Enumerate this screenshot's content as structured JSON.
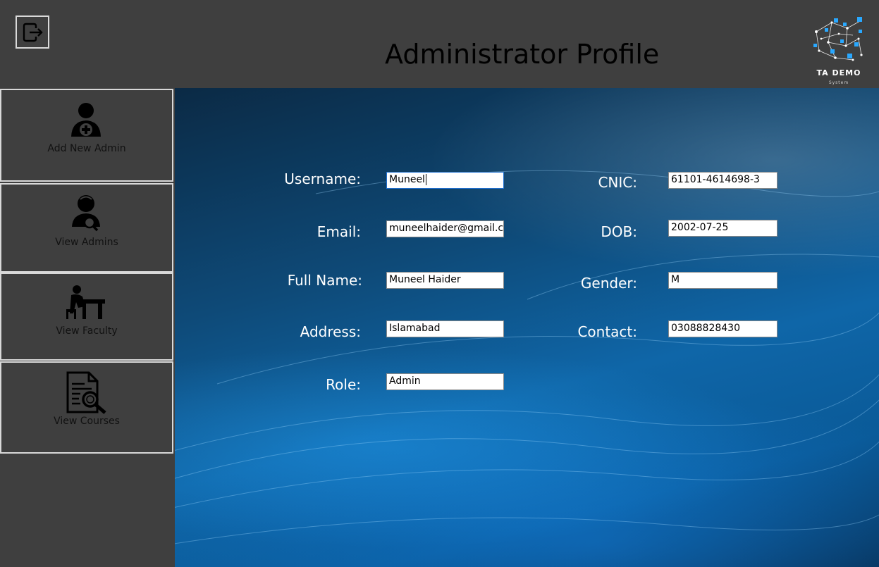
{
  "header": {
    "title": "Administrator Profile",
    "logout_icon": "logout-icon",
    "logo": {
      "name": "TA DEMO",
      "subtitle": "System"
    }
  },
  "sidebar": {
    "items": [
      {
        "label": "Add New Admin",
        "icon": "add-user-icon"
      },
      {
        "label": "View Admins",
        "icon": "search-user-icon"
      },
      {
        "label": "View Faculty",
        "icon": "teacher-desk-icon"
      },
      {
        "label": "View Courses",
        "icon": "document-search-icon"
      }
    ]
  },
  "form": {
    "left": [
      {
        "label": "Username:",
        "value": "Muneel"
      },
      {
        "label": "Email:",
        "value": "muneelhaider@gmail.co"
      },
      {
        "label": "Full Name:",
        "value": "Muneel Haider"
      },
      {
        "label": "Address:",
        "value": "Islamabad"
      },
      {
        "label": "Role:",
        "value": "Admin"
      }
    ],
    "right": [
      {
        "label": "CNIC:",
        "value": "61101-4614698-3"
      },
      {
        "label": "DOB:",
        "value": "2002-07-25"
      },
      {
        "label": "Gender:",
        "value": "M"
      },
      {
        "label": "Contact:",
        "value": "03088828430"
      }
    ]
  },
  "colors": {
    "chrome_bg": "#3f3f3f",
    "border": "#d9d9d9",
    "label_text": "#ffffff",
    "focus_border": "#1f6fd0"
  }
}
